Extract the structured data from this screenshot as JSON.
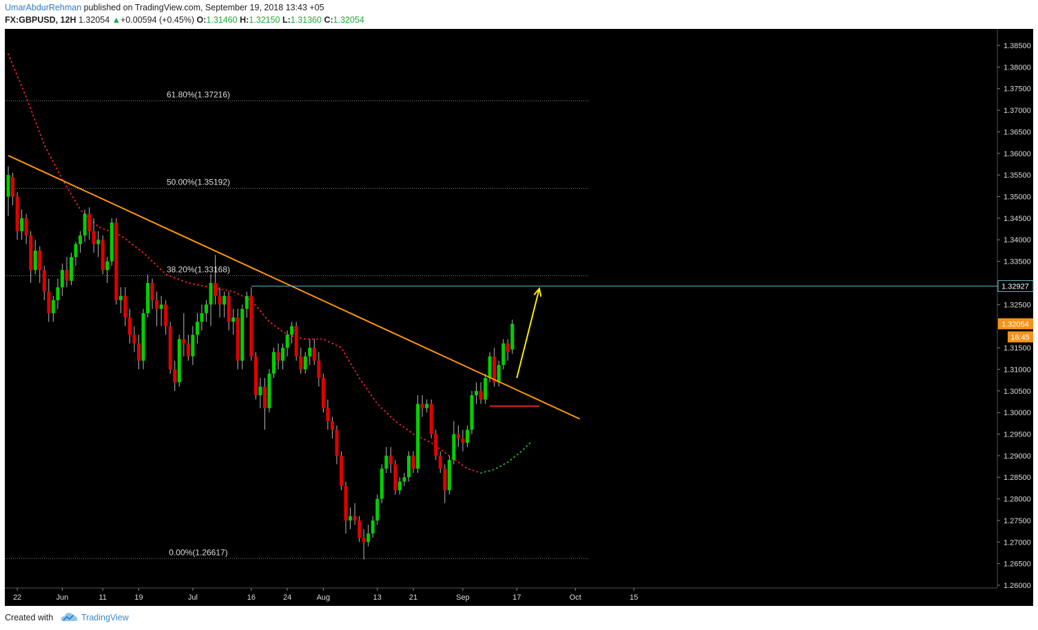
{
  "header": {
    "author": "UmarAbdurRehman",
    "published_text": "published on TradingView.com, September 19, 2018 13:43 +05",
    "symbol": "FX:GBPUSD, 12H",
    "last": "1.32054",
    "change": "+0.00594 (+0.45%)",
    "o_label": "O:",
    "o_value": "1.31460",
    "h_label": "H:",
    "h_value": "1.32150",
    "l_label": "L:",
    "l_value": "1.31360",
    "c_label": "C:",
    "c_value": "1.32054"
  },
  "footer": {
    "created_with": "Created with",
    "brand": "TradingView"
  },
  "colors": {
    "background": "#000000",
    "bull": "#00d000",
    "bear": "#e00000",
    "trendline": "#ff9900",
    "fib": "#888888",
    "resistance": "#5fb8c8",
    "support": "#e02020",
    "arrow": "#ffee00",
    "ma": "#e02020",
    "ma_projection": "#22b022"
  },
  "chart_data": {
    "type": "candlestick",
    "symbol": "FX:GBPUSD",
    "timeframe": "12H",
    "ylim": [
      1.2575,
      1.3875
    ],
    "yticks": [
      "1.26000",
      "1.26500",
      "1.27000",
      "1.27500",
      "1.28000",
      "1.28500",
      "1.29000",
      "1.29500",
      "1.30000",
      "1.30500",
      "1.31000",
      "1.31500",
      "1.32500",
      "1.33000",
      "1.33500",
      "1.34000",
      "1.34500",
      "1.35000",
      "1.35500",
      "1.36000",
      "1.36500",
      "1.37000",
      "1.37500",
      "1.38000",
      "1.38500"
    ],
    "xticks": [
      {
        "label": "22",
        "t": 4
      },
      {
        "label": "Jun",
        "t": 24
      },
      {
        "label": "11",
        "t": 42
      },
      {
        "label": "19",
        "t": 58
      },
      {
        "label": "Jul",
        "t": 82
      },
      {
        "label": "16",
        "t": 108
      },
      {
        "label": "24",
        "t": 124
      },
      {
        "label": "Aug",
        "t": 140
      },
      {
        "label": "13",
        "t": 164
      },
      {
        "label": "21",
        "t": 180
      },
      {
        "label": "Sep",
        "t": 202
      },
      {
        "label": "17",
        "t": 226
      },
      {
        "label": "Oct",
        "t": 252
      },
      {
        "label": "15",
        "t": 278
      }
    ],
    "ohlc": [
      [
        1.35,
        1.357,
        1.3455,
        1.355
      ],
      [
        1.3545,
        1.3555,
        1.348,
        1.35
      ],
      [
        1.35,
        1.351,
        1.34,
        1.342
      ],
      [
        1.342,
        1.347,
        1.34,
        1.345
      ],
      [
        1.345,
        1.346,
        1.339,
        1.341
      ],
      [
        1.341,
        1.342,
        1.33,
        1.333
      ],
      [
        1.333,
        1.34,
        1.332,
        1.3375
      ],
      [
        1.3375,
        1.3385,
        1.33,
        1.333
      ],
      [
        1.333,
        1.334,
        1.326,
        1.328
      ],
      [
        1.328,
        1.331,
        1.321,
        1.323
      ],
      [
        1.323,
        1.327,
        1.321,
        1.326
      ],
      [
        1.326,
        1.331,
        1.324,
        1.329
      ],
      [
        1.329,
        1.3345,
        1.327,
        1.333
      ],
      [
        1.333,
        1.336,
        1.329,
        1.3305
      ],
      [
        1.3305,
        1.337,
        1.3295,
        1.336
      ],
      [
        1.336,
        1.3395,
        1.334,
        1.339
      ],
      [
        1.339,
        1.342,
        1.337,
        1.341
      ],
      [
        1.341,
        1.347,
        1.3395,
        1.346
      ],
      [
        1.346,
        1.3475,
        1.34,
        1.342
      ],
      [
        1.342,
        1.345,
        1.337,
        1.339
      ],
      [
        1.339,
        1.342,
        1.336,
        1.34
      ],
      [
        1.34,
        1.341,
        1.332,
        1.333
      ],
      [
        1.333,
        1.336,
        1.33,
        1.335
      ],
      [
        1.335,
        1.345,
        1.334,
        1.344
      ],
      [
        1.344,
        1.345,
        1.325,
        1.326
      ],
      [
        1.326,
        1.329,
        1.323,
        1.327
      ],
      [
        1.327,
        1.329,
        1.32,
        1.322
      ],
      [
        1.322,
        1.324,
        1.316,
        1.318
      ],
      [
        1.318,
        1.32,
        1.314,
        1.316
      ],
      [
        1.316,
        1.318,
        1.31,
        1.312
      ],
      [
        1.312,
        1.324,
        1.31,
        1.323
      ],
      [
        1.323,
        1.332,
        1.322,
        1.33
      ],
      [
        1.33,
        1.331,
        1.324,
        1.326
      ],
      [
        1.326,
        1.328,
        1.32,
        1.324
      ],
      [
        1.324,
        1.327,
        1.32,
        1.325
      ],
      [
        1.325,
        1.326,
        1.318,
        1.32
      ],
      [
        1.32,
        1.321,
        1.309,
        1.31
      ],
      [
        1.31,
        1.312,
        1.305,
        1.307
      ],
      [
        1.307,
        1.318,
        1.306,
        1.317
      ],
      [
        1.317,
        1.323,
        1.313,
        1.316
      ],
      [
        1.316,
        1.318,
        1.312,
        1.313
      ],
      [
        1.313,
        1.32,
        1.311,
        1.318
      ],
      [
        1.318,
        1.323,
        1.316,
        1.321
      ],
      [
        1.321,
        1.325,
        1.319,
        1.323
      ],
      [
        1.323,
        1.326,
        1.321,
        1.325
      ],
      [
        1.325,
        1.332,
        1.32,
        1.33
      ],
      [
        1.33,
        1.3365,
        1.325,
        1.327
      ],
      [
        1.327,
        1.329,
        1.322,
        1.325
      ],
      [
        1.325,
        1.328,
        1.322,
        1.327
      ],
      [
        1.327,
        1.328,
        1.319,
        1.321
      ],
      [
        1.321,
        1.324,
        1.318,
        1.322
      ],
      [
        1.322,
        1.324,
        1.31,
        1.312
      ],
      [
        1.312,
        1.325,
        1.31,
        1.324
      ],
      [
        1.324,
        1.328,
        1.322,
        1.327
      ],
      [
        1.327,
        1.329,
        1.312,
        1.313
      ],
      [
        1.313,
        1.314,
        1.303,
        1.304
      ],
      [
        1.304,
        1.308,
        1.301,
        1.306
      ],
      [
        1.306,
        1.308,
        1.296,
        1.301
      ],
      [
        1.301,
        1.31,
        1.3,
        1.309
      ],
      [
        1.309,
        1.315,
        1.308,
        1.314
      ],
      [
        1.314,
        1.316,
        1.31,
        1.312
      ],
      [
        1.312,
        1.316,
        1.31,
        1.315
      ],
      [
        1.315,
        1.319,
        1.313,
        1.318
      ],
      [
        1.318,
        1.321,
        1.316,
        1.32
      ],
      [
        1.32,
        1.321,
        1.312,
        1.313
      ],
      [
        1.313,
        1.315,
        1.309,
        1.31
      ],
      [
        1.31,
        1.314,
        1.309,
        1.313
      ],
      [
        1.313,
        1.317,
        1.311,
        1.315
      ],
      [
        1.315,
        1.317,
        1.311,
        1.312
      ],
      [
        1.312,
        1.314,
        1.306,
        1.308
      ],
      [
        1.308,
        1.309,
        1.3,
        1.301
      ],
      [
        1.301,
        1.303,
        1.296,
        1.298
      ],
      [
        1.298,
        1.299,
        1.294,
        1.296
      ],
      [
        1.296,
        1.297,
        1.288,
        1.29
      ],
      [
        1.29,
        1.291,
        1.282,
        1.283
      ],
      [
        1.283,
        1.284,
        1.272,
        1.275
      ],
      [
        1.275,
        1.278,
        1.273,
        1.276
      ],
      [
        1.276,
        1.279,
        1.274,
        1.275
      ],
      [
        1.275,
        1.276,
        1.27,
        1.271
      ],
      [
        1.271,
        1.273,
        1.266,
        1.27
      ],
      [
        1.27,
        1.274,
        1.269,
        1.272
      ],
      [
        1.272,
        1.276,
        1.271,
        1.275
      ],
      [
        1.275,
        1.281,
        1.274,
        1.28
      ],
      [
        1.28,
        1.288,
        1.279,
        1.287
      ],
      [
        1.287,
        1.292,
        1.286,
        1.29
      ],
      [
        1.29,
        1.292,
        1.286,
        1.288
      ],
      [
        1.288,
        1.289,
        1.281,
        1.282
      ],
      [
        1.282,
        1.285,
        1.281,
        1.284
      ],
      [
        1.284,
        1.286,
        1.283,
        1.285
      ],
      [
        1.285,
        1.291,
        1.284,
        1.29
      ],
      [
        1.29,
        1.291,
        1.286,
        1.287
      ],
      [
        1.287,
        1.304,
        1.286,
        1.302
      ],
      [
        1.302,
        1.304,
        1.299,
        1.301
      ],
      [
        1.301,
        1.303,
        1.3,
        1.302
      ],
      [
        1.302,
        1.303,
        1.294,
        1.295
      ],
      [
        1.295,
        1.296,
        1.289,
        1.29
      ],
      [
        1.29,
        1.291,
        1.286,
        1.287
      ],
      [
        1.287,
        1.288,
        1.279,
        1.282
      ],
      [
        1.282,
        1.29,
        1.281,
        1.289
      ],
      [
        1.289,
        1.298,
        1.288,
        1.295
      ],
      [
        1.295,
        1.297,
        1.292,
        1.294
      ],
      [
        1.294,
        1.296,
        1.291,
        1.293
      ],
      [
        1.293,
        1.297,
        1.292,
        1.296
      ],
      [
        1.296,
        1.305,
        1.295,
        1.304
      ],
      [
        1.304,
        1.307,
        1.302,
        1.305
      ],
      [
        1.305,
        1.307,
        1.302,
        1.303
      ],
      [
        1.303,
        1.309,
        1.302,
        1.308
      ],
      [
        1.308,
        1.314,
        1.307,
        1.313
      ],
      [
        1.313,
        1.315,
        1.306,
        1.307
      ],
      [
        1.307,
        1.312,
        1.306,
        1.311
      ],
      [
        1.311,
        1.317,
        1.31,
        1.316
      ],
      [
        1.316,
        1.317,
        1.312,
        1.314
      ],
      [
        1.3146,
        1.3215,
        1.3136,
        1.32054
      ]
    ],
    "candle_times": [
      0,
      2,
      4,
      6,
      8,
      10,
      12,
      14,
      16,
      18,
      20,
      22,
      24,
      26,
      28,
      30,
      32,
      34,
      36,
      38,
      40,
      42,
      44,
      46,
      48,
      50,
      52,
      54,
      56,
      58,
      60,
      62,
      64,
      66,
      68,
      70,
      72,
      74,
      76,
      78,
      80,
      82,
      84,
      86,
      88,
      90,
      92,
      94,
      96,
      98,
      100,
      102,
      104,
      106,
      108,
      110,
      112,
      114,
      116,
      118,
      120,
      122,
      124,
      126,
      128,
      130,
      132,
      134,
      136,
      138,
      140,
      142,
      144,
      146,
      148,
      150,
      152,
      154,
      156,
      158,
      160,
      162,
      164,
      166,
      168,
      170,
      172,
      174,
      176,
      178,
      180,
      182,
      184,
      186,
      188,
      190,
      192,
      194,
      196,
      198,
      200,
      202,
      204,
      206,
      208,
      210,
      212,
      214,
      216,
      218,
      220,
      222,
      224,
      226,
      228
    ],
    "fibonacci": [
      {
        "label": "61.80%(1.37216)",
        "price": 1.37216
      },
      {
        "label": "50.00%(1.35192)",
        "price": 1.35192
      },
      {
        "label": "38.20%(1.33168)",
        "price": 1.33168
      },
      {
        "label": "0.00%(1.26617)",
        "price": 1.26617
      }
    ],
    "trendline": {
      "start": {
        "t": 0,
        "price": 1.3595
      },
      "end": {
        "t": 254,
        "price": 1.2985
      }
    },
    "resistance_level": {
      "price": 1.32927,
      "label": "1.32927",
      "t_start": 108
    },
    "support_segment": {
      "price": 1.3015,
      "t_start": 214,
      "t_end": 236
    },
    "projection_arrow": {
      "start": {
        "t": 226,
        "price": 1.308
      },
      "end": {
        "t": 236,
        "price": 1.3287
      }
    },
    "moving_average": [
      {
        "t": 0,
        "price": 1.383
      },
      {
        "t": 8,
        "price": 1.373
      },
      {
        "t": 16,
        "price": 1.362
      },
      {
        "t": 24,
        "price": 1.354
      },
      {
        "t": 32,
        "price": 1.347
      },
      {
        "t": 40,
        "price": 1.343
      },
      {
        "t": 50,
        "price": 1.341
      },
      {
        "t": 60,
        "price": 1.337
      },
      {
        "t": 70,
        "price": 1.332
      },
      {
        "t": 80,
        "price": 1.33
      },
      {
        "t": 90,
        "price": 1.329
      },
      {
        "t": 100,
        "price": 1.328
      },
      {
        "t": 108,
        "price": 1.326
      },
      {
        "t": 116,
        "price": 1.321
      },
      {
        "t": 124,
        "price": 1.318
      },
      {
        "t": 132,
        "price": 1.317
      },
      {
        "t": 140,
        "price": 1.317
      },
      {
        "t": 148,
        "price": 1.315
      },
      {
        "t": 156,
        "price": 1.308
      },
      {
        "t": 164,
        "price": 1.302
      },
      {
        "t": 172,
        "price": 1.298
      },
      {
        "t": 180,
        "price": 1.295
      },
      {
        "t": 188,
        "price": 1.293
      },
      {
        "t": 196,
        "price": 1.29
      },
      {
        "t": 204,
        "price": 1.287
      },
      {
        "t": 210,
        "price": 1.286
      }
    ],
    "ma_projection": [
      {
        "t": 210,
        "price": 1.286
      },
      {
        "t": 216,
        "price": 1.2868
      },
      {
        "t": 222,
        "price": 1.2885
      },
      {
        "t": 228,
        "price": 1.291
      },
      {
        "t": 232,
        "price": 1.293
      }
    ],
    "current_price_label": "1.32054",
    "countdown_label": "16:45"
  }
}
